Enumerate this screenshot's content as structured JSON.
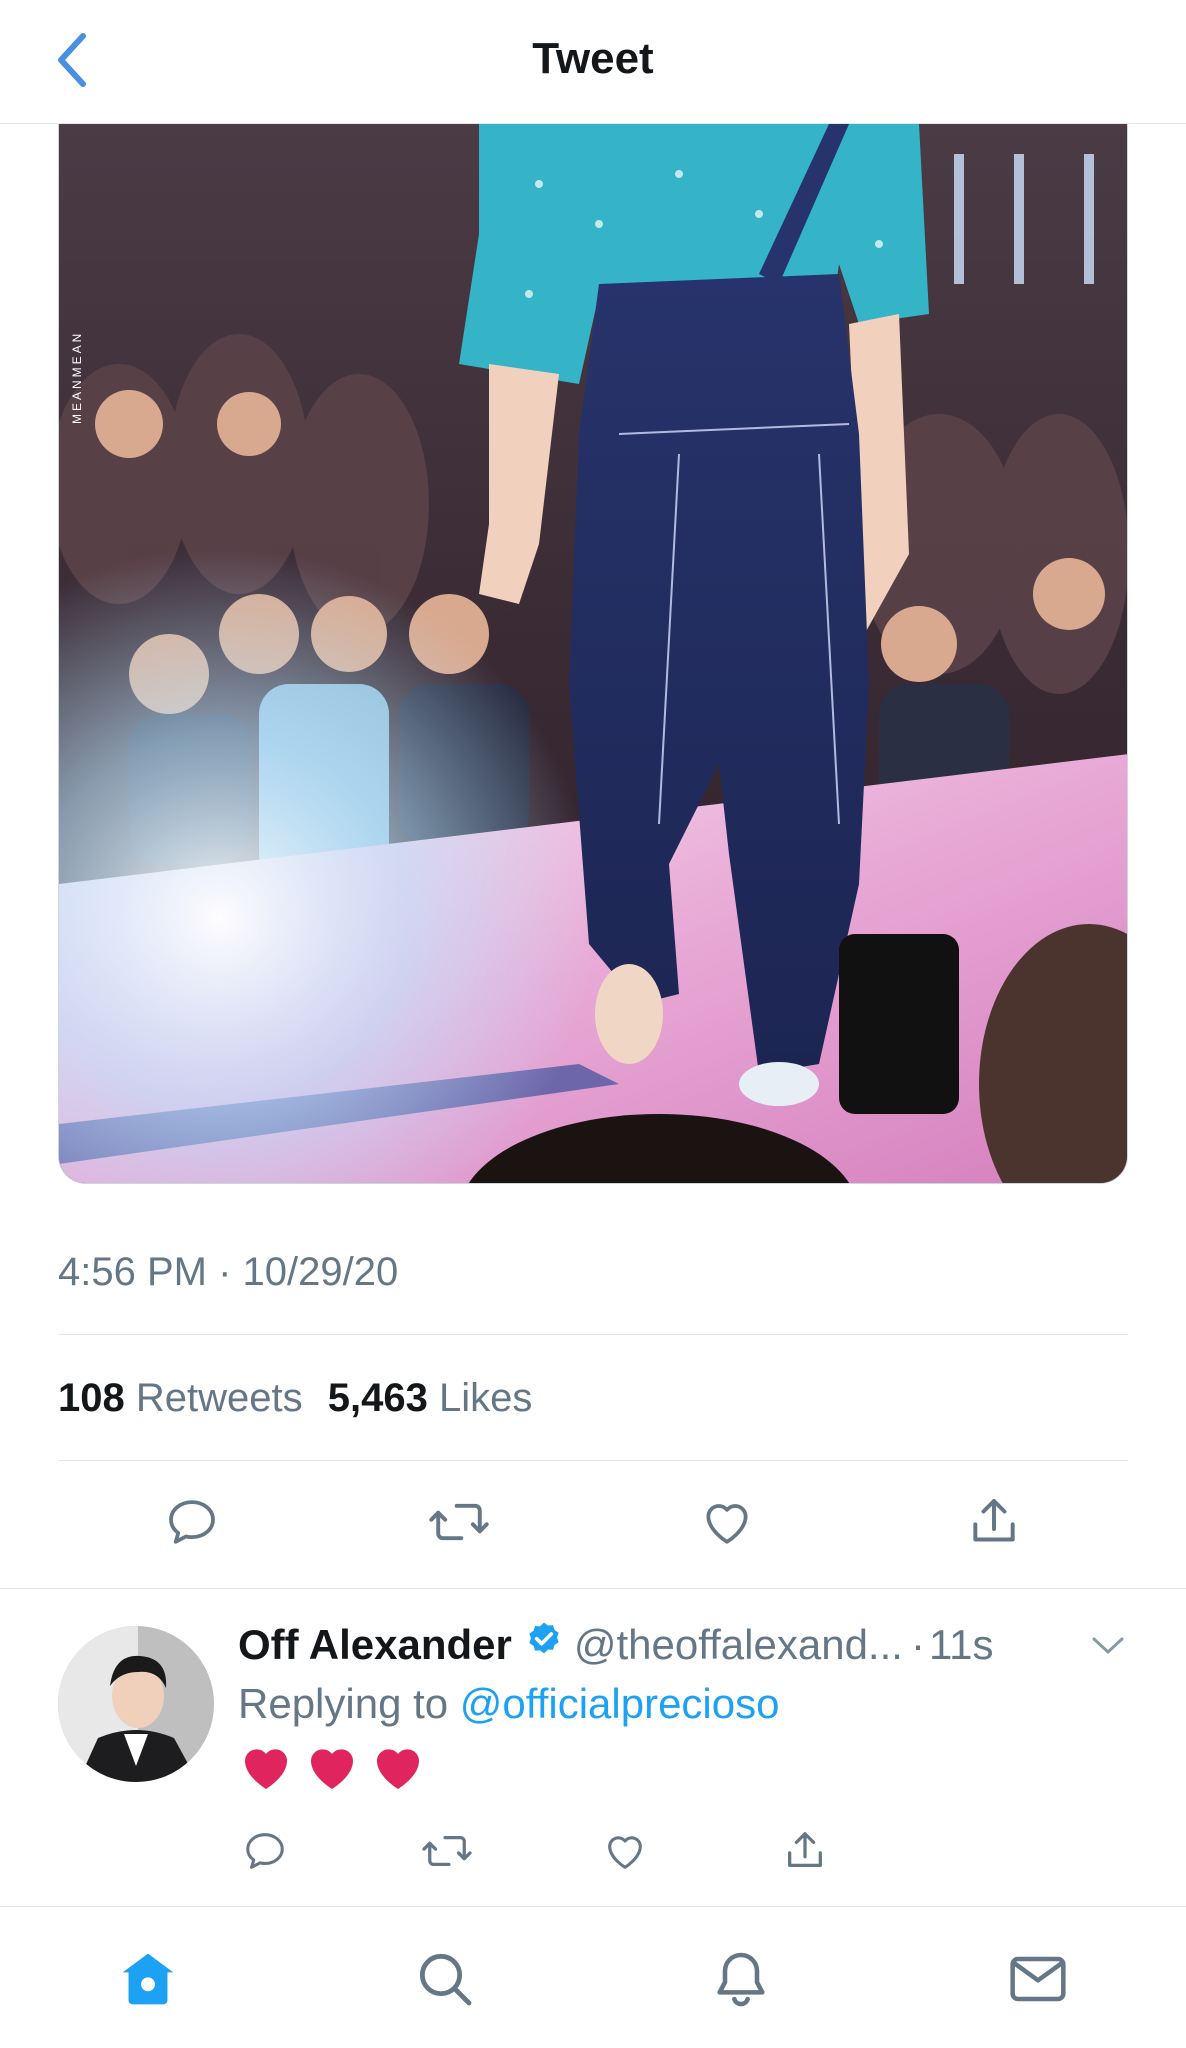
{
  "colors": {
    "accent": "#1da1f2",
    "back_blue": "#4a90e2",
    "verified": "#1da1f2",
    "heart_red": "#e0245e",
    "muted": "#657786"
  },
  "header": {
    "title": "Tweet",
    "back_icon": "chevron-left-icon"
  },
  "media": {
    "watermark": "MEANMEAN"
  },
  "tweet": {
    "timestamp": "4:56 PM · 10/29/20",
    "retweets_count": "108",
    "retweets_label": "Retweets",
    "likes_count": "5,463",
    "likes_label": "Likes",
    "actions": [
      "reply-icon",
      "retweet-icon",
      "like-icon",
      "share-icon"
    ]
  },
  "reply": {
    "name": "Off Alexander",
    "handle": "@theoffalexand...",
    "separator": "·",
    "time": "11s",
    "replying_prefix": "Replying to",
    "replying_to": "@officialprecioso",
    "content": "❤️❤️❤️",
    "actions": [
      "reply-icon",
      "retweet-icon",
      "like-icon",
      "share-icon"
    ]
  },
  "tabbar": {
    "items": [
      "home-icon",
      "search-icon",
      "notifications-icon",
      "messages-icon"
    ],
    "active": "home-icon"
  }
}
